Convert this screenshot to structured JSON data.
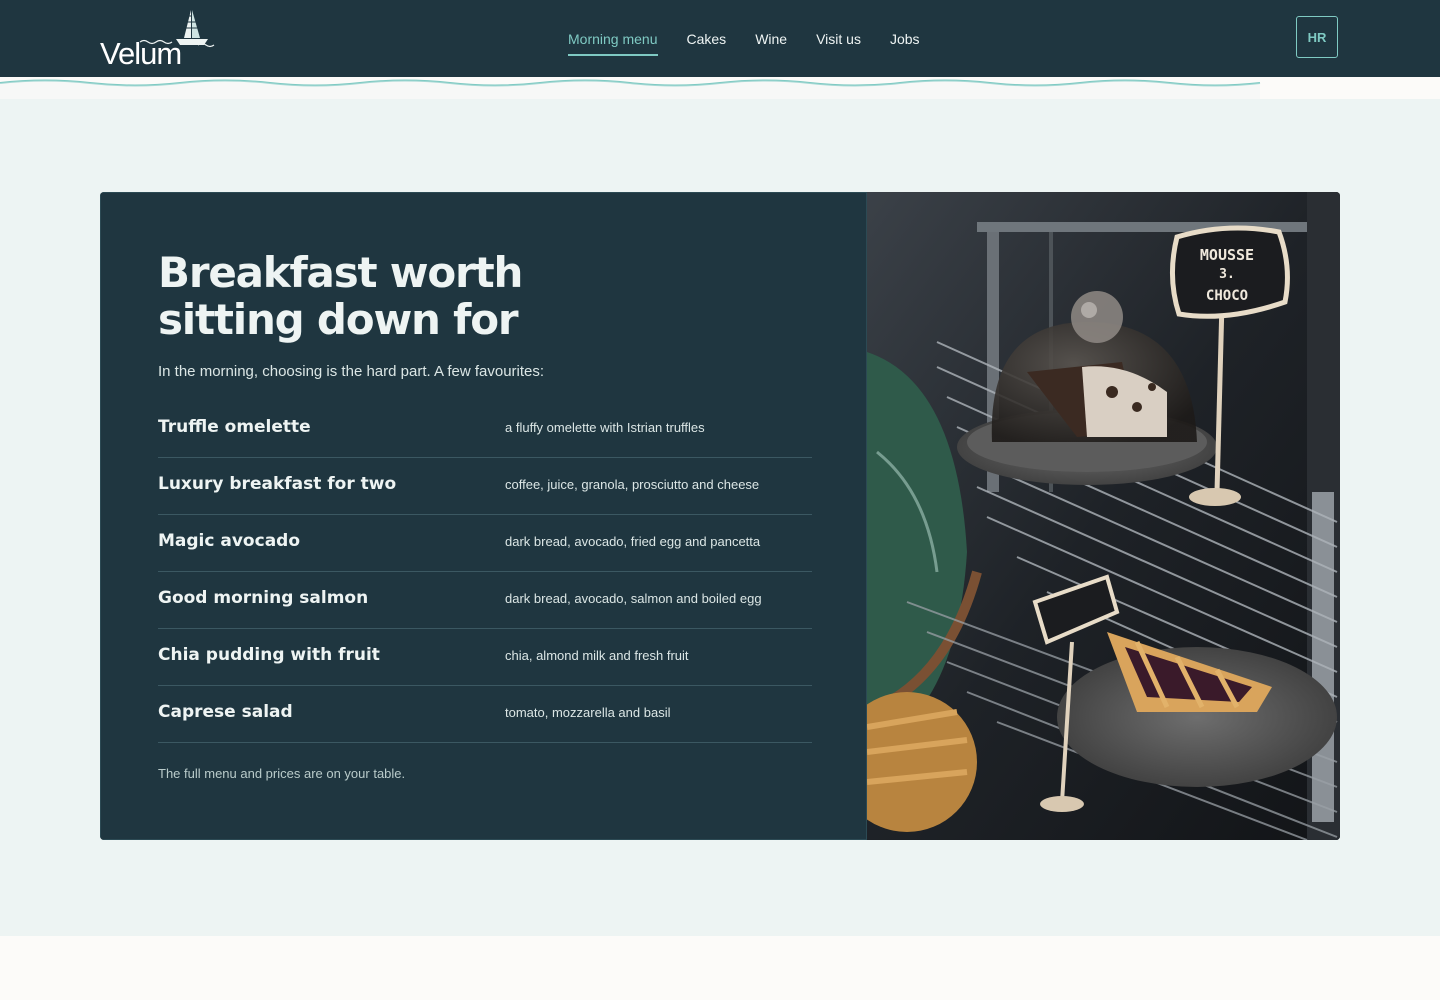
{
  "header": {
    "logo_text": "Velum",
    "nav": [
      {
        "label": "Morning menu",
        "active": true
      },
      {
        "label": "Cakes",
        "active": false
      },
      {
        "label": "Wine",
        "active": false
      },
      {
        "label": "Visit us",
        "active": false
      },
      {
        "label": "Jobs",
        "active": false
      }
    ],
    "language_button": "HR"
  },
  "main": {
    "title_line1": "Breakfast worth",
    "title_line2": "sitting down for",
    "intro": "In the morning, choosing is the hard part. A few favourites:",
    "menu_items": [
      {
        "name": "Truffle omelette",
        "description": "a fluffy omelette with Istrian truffles"
      },
      {
        "name": "Luxury breakfast for two",
        "description": "coffee, juice, granola, prosciutto and cheese"
      },
      {
        "name": "Magic avocado",
        "description": "dark bread, avocado, fried egg and pancetta"
      },
      {
        "name": "Good morning salmon",
        "description": "dark bread, avocado, salmon and boiled egg"
      },
      {
        "name": "Chia pudding with fruit",
        "description": "chia, almond milk and fresh fruit"
      },
      {
        "name": "Caprese salad",
        "description": "tomato, mozzarella and basil"
      }
    ],
    "footnote": "The full menu and prices are on your table.",
    "photo_sign_text": [
      "MOUSSE",
      "3.",
      "CHOCO"
    ]
  },
  "colors": {
    "header_bg": "#1f3640",
    "accent": "#7fcac3",
    "section_bg": "#edf4f3"
  }
}
